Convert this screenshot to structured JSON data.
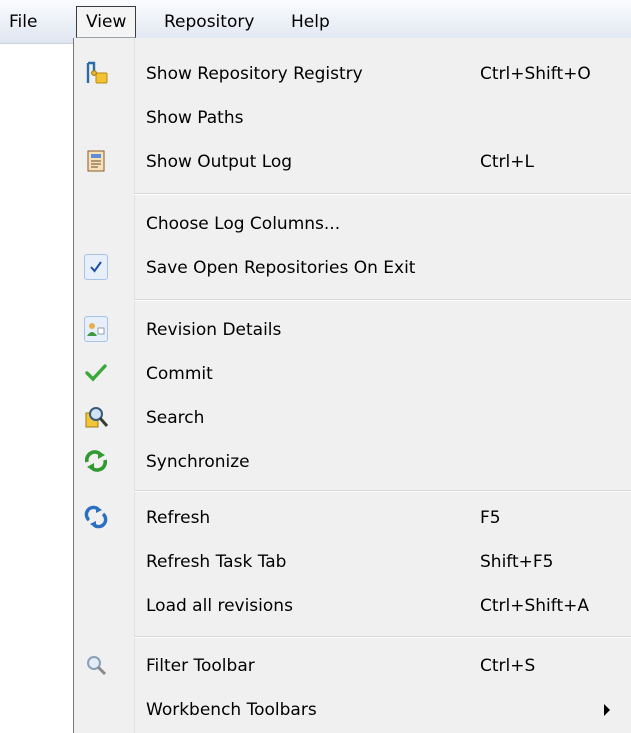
{
  "menubar": {
    "items": [
      {
        "label": "File"
      },
      {
        "label": "View"
      },
      {
        "label": "Repository"
      },
      {
        "label": "Help"
      }
    ]
  },
  "view_menu": {
    "items": [
      {
        "label": "Show Repository Registry",
        "accel": "Ctrl+Shift+O",
        "icon": "repository-registry-icon"
      },
      {
        "label": "Show Paths",
        "accel": ""
      },
      {
        "label": "Show Output Log",
        "accel": "Ctrl+L",
        "icon": "output-log-icon"
      },
      {
        "label": "Choose Log Columns...",
        "accel": ""
      },
      {
        "label": "Save Open Repositories On Exit",
        "accel": "",
        "checked": true
      },
      {
        "label": "Revision Details",
        "accel": "",
        "checked": true,
        "icon": "revision-details-icon"
      },
      {
        "label": "Commit",
        "accel": "",
        "icon": "commit-icon"
      },
      {
        "label": "Search",
        "accel": "",
        "icon": "search-icon"
      },
      {
        "label": "Synchronize",
        "accel": "",
        "icon": "synchronize-icon"
      },
      {
        "label": "Refresh",
        "accel": "F5",
        "icon": "refresh-icon"
      },
      {
        "label": "Refresh Task Tab",
        "accel": "Shift+F5"
      },
      {
        "label": "Load all revisions",
        "accel": "Ctrl+Shift+A"
      },
      {
        "label": "Filter Toolbar",
        "accel": "Ctrl+S",
        "icon": "filter-icon"
      },
      {
        "label": "Workbench Toolbars",
        "accel": "",
        "submenu": true
      }
    ]
  },
  "colors": {
    "menu_background": "#f0f0f0",
    "check_blue": "#1e50a8",
    "commit_green": "#3aa83a"
  }
}
